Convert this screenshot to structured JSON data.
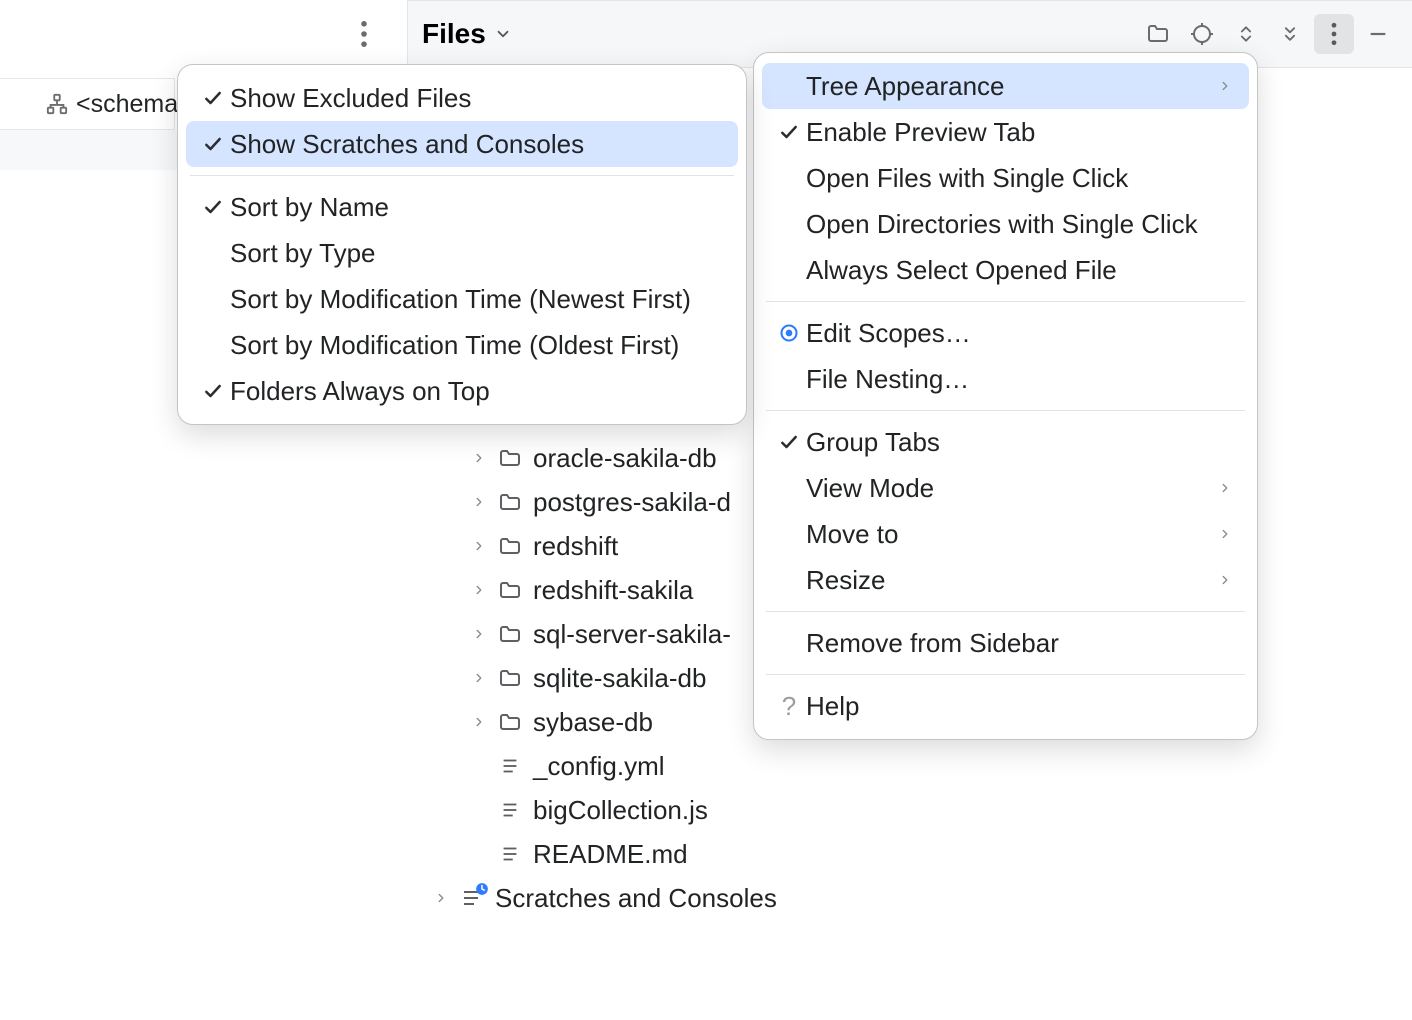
{
  "header": {
    "title": "Files"
  },
  "schema_tab": "<schema",
  "tree": {
    "folders": [
      "oracle-sakila-db",
      "postgres-sakila-d",
      "redshift",
      "redshift-sakila",
      "sql-server-sakila-",
      "sqlite-sakila-db",
      "sybase-db"
    ],
    "files": [
      "_config.yml",
      "bigCollection.js",
      "README.md"
    ],
    "scratches": "Scratches and Consoles"
  },
  "right_menu": {
    "items": [
      {
        "label": "Tree Appearance",
        "check": false,
        "submenu": true,
        "highlight": true
      },
      {
        "label": "Enable Preview Tab",
        "check": true,
        "submenu": false
      },
      {
        "label": "Open Files with Single Click",
        "check": false,
        "submenu": false
      },
      {
        "label": "Open Directories with Single Click",
        "check": false,
        "submenu": false
      },
      {
        "label": "Always Select Opened File",
        "check": false,
        "submenu": false
      }
    ],
    "group2": [
      {
        "label": "Edit Scopes…",
        "radio": true
      },
      {
        "label": "File Nesting…"
      }
    ],
    "group3": [
      {
        "label": "Group Tabs",
        "check": true
      },
      {
        "label": "View Mode",
        "submenu": true
      },
      {
        "label": "Move to",
        "submenu": true
      },
      {
        "label": "Resize",
        "submenu": true
      }
    ],
    "group4": [
      {
        "label": "Remove from Sidebar"
      }
    ],
    "group5": [
      {
        "label": "Help",
        "help": true
      }
    ]
  },
  "left_menu": {
    "group1": [
      {
        "label": "Show Excluded Files",
        "check": true
      },
      {
        "label": "Show Scratches and Consoles",
        "check": true,
        "highlight": true
      }
    ],
    "group2": [
      {
        "label": "Sort by Name",
        "check": true
      },
      {
        "label": "Sort by Type"
      },
      {
        "label": "Sort by Modification Time (Newest First)"
      },
      {
        "label": "Sort by Modification Time (Oldest First)"
      },
      {
        "label": "Folders Always on Top",
        "check": true
      }
    ]
  }
}
